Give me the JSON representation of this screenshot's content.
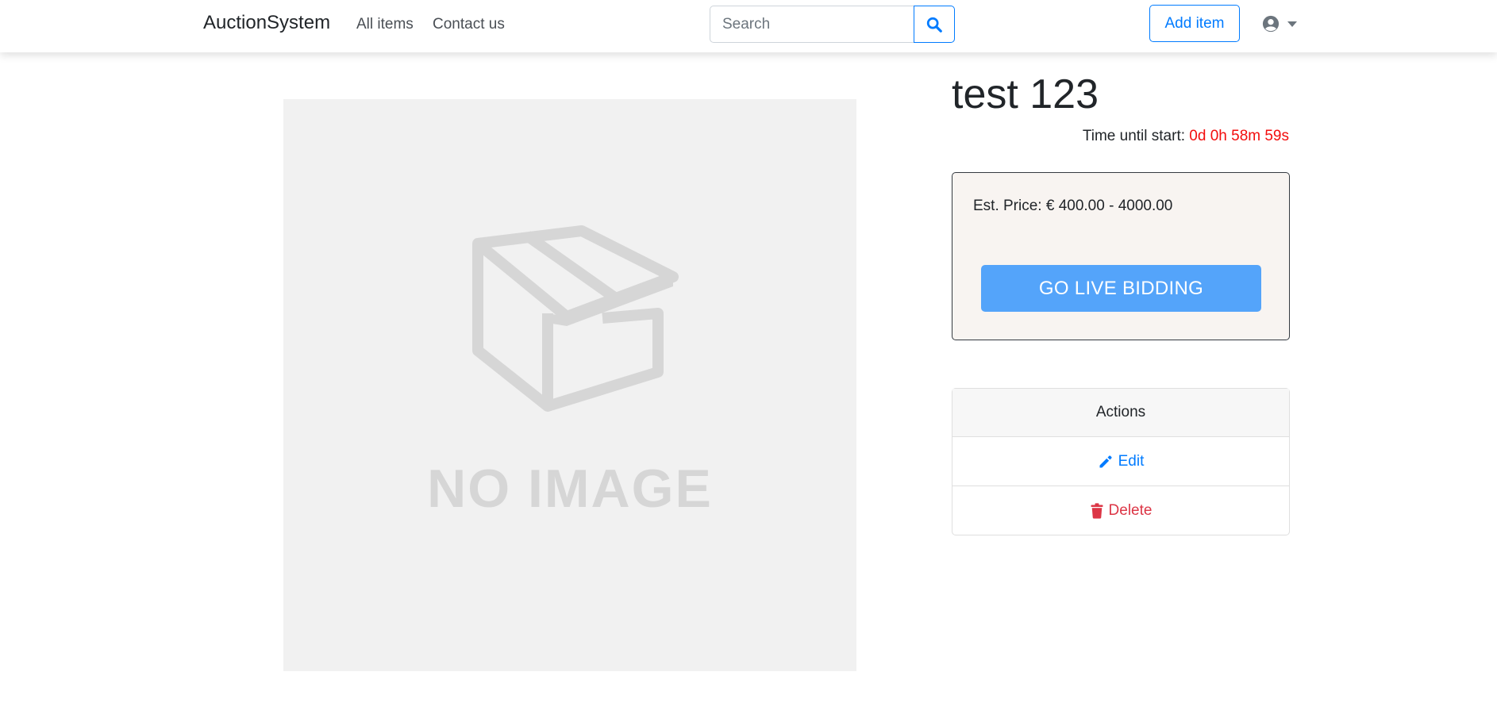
{
  "navbar": {
    "brand": "AuctionSystem",
    "links": [
      {
        "label": "All items"
      },
      {
        "label": "Contact us"
      }
    ],
    "search": {
      "placeholder": "Search",
      "value": ""
    },
    "add_item_label": "Add item",
    "icons": {
      "search": "search-icon",
      "user": "user-circle-icon",
      "dropdown": "caret-down-icon"
    },
    "accent_color": "#007bff"
  },
  "item": {
    "title": "test 123",
    "image_placeholder_text": "NO IMAGE",
    "timer": {
      "label": "Time until start:",
      "value": "0d 0h 58m 59s",
      "value_color": "#f30d0d"
    },
    "price": {
      "label": "Est. Price: € 400.00 - 4000.00"
    },
    "live_bidding_label": "GO LIVE BIDDING"
  },
  "actions": {
    "header": "Actions",
    "edit": {
      "label": "Edit",
      "icon": "pencil-icon",
      "color": "#007bff"
    },
    "delete": {
      "label": "Delete",
      "icon": "trash-icon",
      "color": "#dc3545"
    }
  }
}
